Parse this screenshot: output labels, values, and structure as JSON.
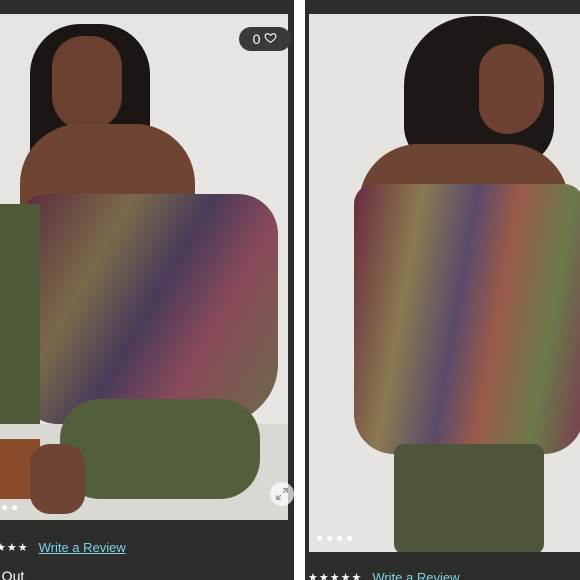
{
  "left_card": {
    "wishlist_count": "0",
    "wishlist_icon": "heart-icon",
    "expand_icon": "expand-icon",
    "dots_count": 2,
    "review_stars": "★★★",
    "review_link": "Write a Review",
    "status_text": "d Out"
  },
  "right_card": {
    "dots_count": 4,
    "review_stars": "★★★★★",
    "review_link": "Write a Review"
  },
  "colors": {
    "panel_bg": "#2d2d2b",
    "photo_bg": "#e8e7e3",
    "link": "#7fd3e6"
  }
}
